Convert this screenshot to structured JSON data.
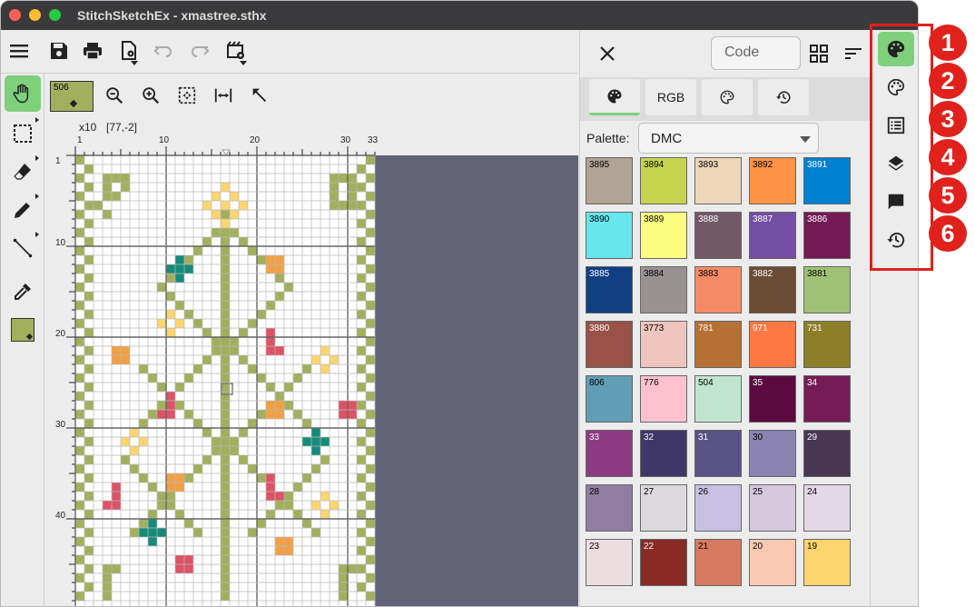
{
  "window": {
    "title": "StitchSketchEx - xmastree.sthx",
    "traffic_lights": [
      "#fe5f57",
      "#febc2e",
      "#28c840"
    ]
  },
  "toolbar": {
    "icons": [
      "menu-icon",
      "save-icon",
      "print-icon",
      "file-settings-icon",
      "undo-icon",
      "redo-icon",
      "export-icon"
    ]
  },
  "left_tools": {
    "icons": [
      "hand-icon",
      "select-icon",
      "eraser-icon",
      "pencil-icon",
      "line-icon",
      "eyedropper-icon",
      "color-swatch-icon"
    ],
    "accent": "#7ed07a"
  },
  "canvas_tools": {
    "current_color_code": "506",
    "current_color": "#a2b05e",
    "icons": [
      "zoom-out-icon",
      "zoom-in-icon",
      "zoom-fit-icon",
      "fit-width-icon",
      "pointer-icon"
    ]
  },
  "canvas": {
    "zoom_label": "x10",
    "coords": "[77,-2]",
    "col_ruler_labels": [
      "1",
      "10",
      "20",
      "30",
      "33"
    ],
    "row_ruler_labels": [
      "1",
      "10",
      "20",
      "30",
      "40"
    ],
    "background": "#636378",
    "stitch_colors": {
      "green": "#a2b05e",
      "teal": "#168a7a",
      "orange": "#f3a044",
      "yellow": "#fcd570",
      "red": "#dc5366"
    }
  },
  "panel": {
    "code_placeholder": "Code",
    "tabs": [
      {
        "icon": "palette-filled-icon",
        "label": ""
      },
      {
        "icon": "",
        "label": "RGB"
      },
      {
        "icon": "palette-outline-icon",
        "label": ""
      },
      {
        "icon": "history-icon",
        "label": ""
      }
    ],
    "palette_label": "Palette:",
    "palette_value": "DMC",
    "swatches": [
      {
        "code": "3895",
        "color": "#b0a394",
        "text": "#000"
      },
      {
        "code": "3894",
        "color": "#c4d44d",
        "text": "#000"
      },
      {
        "code": "3893",
        "color": "#eed6b9",
        "text": "#000"
      },
      {
        "code": "3892",
        "color": "#fe9345",
        "text": "#000"
      },
      {
        "code": "3891",
        "color": "#0080d0",
        "text": "#fff"
      },
      {
        "code": "3890",
        "color": "#67e6ee",
        "text": "#000"
      },
      {
        "code": "3889",
        "color": "#fbfb80",
        "text": "#000"
      },
      {
        "code": "3888",
        "color": "#735866",
        "text": "#fff"
      },
      {
        "code": "3887",
        "color": "#744ea3",
        "text": "#fff"
      },
      {
        "code": "3886",
        "color": "#731a55",
        "text": "#fff"
      },
      {
        "code": "3885",
        "color": "#113f84",
        "text": "#fff"
      },
      {
        "code": "3884",
        "color": "#999293",
        "text": "#000"
      },
      {
        "code": "3883",
        "color": "#f78a66",
        "text": "#000"
      },
      {
        "code": "3882",
        "color": "#6b4c34",
        "text": "#fff"
      },
      {
        "code": "3881",
        "color": "#9fc275",
        "text": "#000"
      },
      {
        "code": "3880",
        "color": "#9a5148",
        "text": "#fff"
      },
      {
        "code": "3773",
        "color": "#efc5bd",
        "text": "#000"
      },
      {
        "code": "781",
        "color": "#b87134",
        "text": "#fff"
      },
      {
        "code": "971",
        "color": "#fe7844",
        "text": "#fff"
      },
      {
        "code": "731",
        "color": "#8d7f28",
        "text": "#fff"
      },
      {
        "code": "806",
        "color": "#609eb5",
        "text": "#000"
      },
      {
        "code": "776",
        "color": "#fdc1cf",
        "text": "#000"
      },
      {
        "code": "504",
        "color": "#c1e4d0",
        "text": "#000"
      },
      {
        "code": "35",
        "color": "#5a0a3f",
        "text": "#fff"
      },
      {
        "code": "34",
        "color": "#751c57",
        "text": "#fff"
      },
      {
        "code": "33",
        "color": "#8e3b86",
        "text": "#fff"
      },
      {
        "code": "32",
        "color": "#403769",
        "text": "#fff"
      },
      {
        "code": "31",
        "color": "#5a5385",
        "text": "#fff"
      },
      {
        "code": "30",
        "color": "#8b83b1",
        "text": "#000"
      },
      {
        "code": "29",
        "color": "#473753",
        "text": "#fff"
      },
      {
        "code": "28",
        "color": "#8f7ea2",
        "text": "#000"
      },
      {
        "code": "27",
        "color": "#dcd8de",
        "text": "#000"
      },
      {
        "code": "26",
        "color": "#c8c0e2",
        "text": "#000"
      },
      {
        "code": "25",
        "color": "#d5c8dc",
        "text": "#000"
      },
      {
        "code": "24",
        "color": "#e3d8e5",
        "text": "#000"
      },
      {
        "code": "23",
        "color": "#ecdde0",
        "text": "#000"
      },
      {
        "code": "22",
        "color": "#8a2a26",
        "text": "#fff"
      },
      {
        "code": "21",
        "color": "#d77a62",
        "text": "#000"
      },
      {
        "code": "20",
        "color": "#f9c9b1",
        "text": "#000"
      },
      {
        "code": "19",
        "color": "#fcd56e",
        "text": "#000"
      }
    ]
  },
  "side_strip": {
    "icons": [
      "palette-filled-icon",
      "palette-outline-icon",
      "list-icon",
      "layers-icon",
      "comment-icon",
      "history-icon"
    ],
    "active_color": "#7ed07a"
  },
  "annotations": {
    "badges": [
      "1",
      "2",
      "3",
      "4",
      "5",
      "6"
    ],
    "color": "#e0211c"
  }
}
